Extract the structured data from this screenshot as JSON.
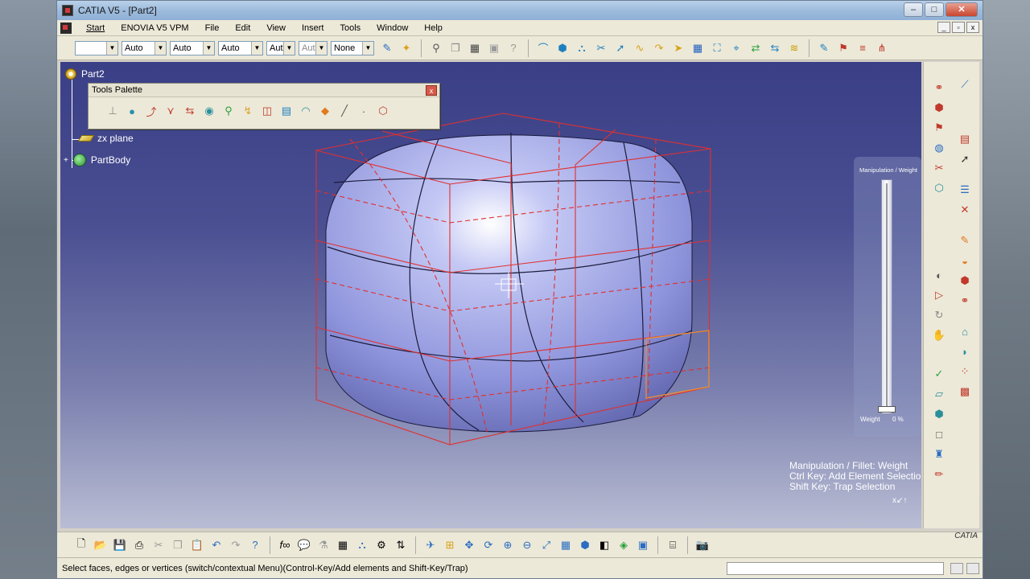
{
  "window": {
    "title": "CATIA V5 - [Part2]"
  },
  "menubar": {
    "items": [
      "Start",
      "ENOVIA V5 VPM",
      "File",
      "Edit",
      "View",
      "Insert",
      "Tools",
      "Window",
      "Help"
    ]
  },
  "toolbar": {
    "combos": [
      "",
      "Auto",
      "Auto",
      "Auto",
      "Aut",
      "Aut",
      "None"
    ]
  },
  "tree": {
    "root": "Part2",
    "plane": "zx plane",
    "body": "PartBody"
  },
  "palette": {
    "title": "Tools Palette",
    "close": "x"
  },
  "slider": {
    "label": "Manipulation / Weight",
    "weight_label": "Weight",
    "weight_value": "0 %",
    "level_fraction": 0.0
  },
  "hint": {
    "line1": "Manipulation / Fillet: Weight",
    "line2": "Ctrl Key: Add Element Selectio",
    "line3": "Shift Key: Trap Selection"
  },
  "axis": {
    "label": "x"
  },
  "statusbar": {
    "message": "Select faces, edges or vertices (switch/contextual Menu)(Control-Key/Add elements and Shift-Key/Trap)"
  },
  "logo": {
    "text": "CATIA"
  },
  "colors": {
    "viewport_top": "#3a3f86",
    "viewport_bottom": "#b9bdd4",
    "cage_red": "#e03030",
    "surface": "#9aa0e6"
  }
}
